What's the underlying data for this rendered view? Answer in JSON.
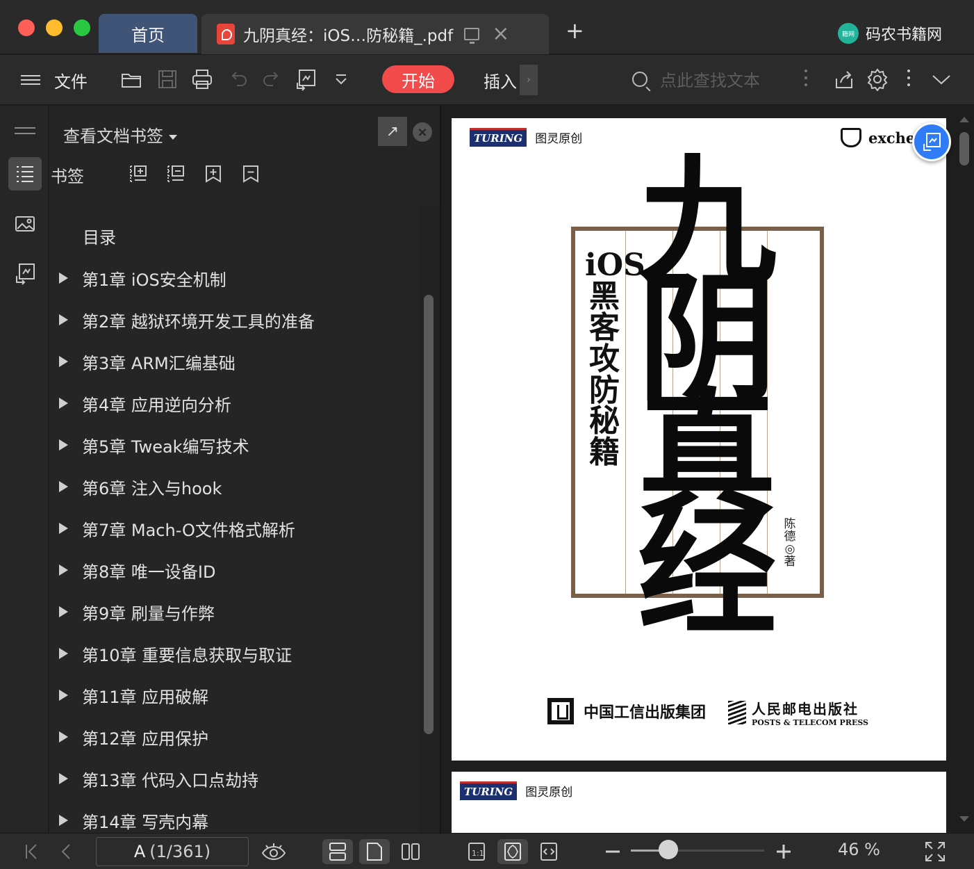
{
  "window": {
    "tabs": [
      {
        "label": "首页",
        "active": false
      },
      {
        "label": "九阴真经：iOS…防秘籍_.pdf",
        "active": true
      }
    ],
    "brand": "码农书籍网",
    "brand_logo_text": "籍网"
  },
  "toolbar": {
    "file_label": "文件",
    "start_label": "开始",
    "insert_label": "插入",
    "search_placeholder": "点此查找文本",
    "accent_color": "#f24b4b"
  },
  "panel": {
    "title": "查看文档书签",
    "bookmarks_label": "书签",
    "toc_root": "目录",
    "toc": [
      "第1章 iOS安全机制",
      "第2章 越狱环境开发工具的准备",
      "第3章 ARM汇编基础",
      "第4章 应用逆向分析",
      "第5章 Tweak编写技术",
      "第6章 注入与hook",
      "第7章 Mach-O文件格式解析",
      "第8章 唯一设备ID",
      "第9章 刷量与作弊",
      "第10章 重要信息获取与取证",
      "第11章 应用破解",
      "第12章 应用保护",
      "第13章 代码入口点劫持",
      "第14章 写壳内幕"
    ]
  },
  "cover": {
    "series_logo": "TURING",
    "series_name": "图灵原创",
    "corner_brand": "exche",
    "title_calligraphy": [
      "九",
      "阴",
      "真",
      "经"
    ],
    "subtitle": "iOS黑客攻防秘籍",
    "author_lines": [
      "陈",
      "德",
      "◎",
      "著"
    ],
    "publisher_group": "中国工信出版集团",
    "publisher_cn": "人民邮电出版社",
    "publisher_en": "POSTS & TELECOM PRESS"
  },
  "page2": {
    "series_logo": "TURING",
    "series_name": "图灵原创"
  },
  "statusbar": {
    "page_current": "A",
    "page_total": "(1/361)",
    "zoom_percent": "46 %",
    "zoom_level": 0.46
  }
}
